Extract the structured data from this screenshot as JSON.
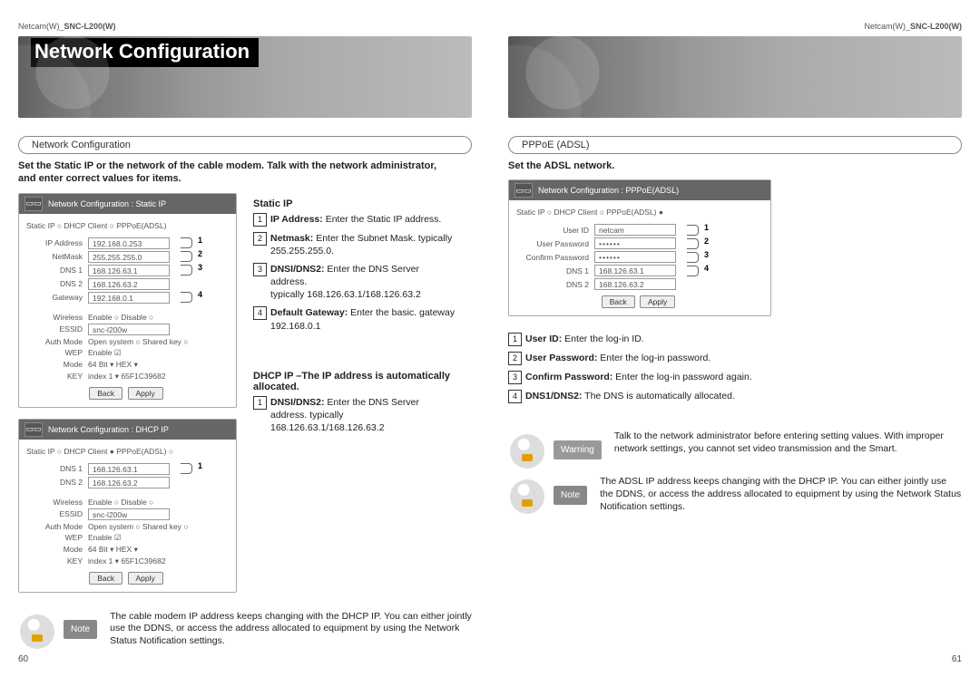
{
  "header": {
    "model_left": "Netcam(W)_",
    "model_bold": "SNC-L200(W)",
    "title": "Network Configuration"
  },
  "left": {
    "chip": "Network Configuration",
    "intro": "Set the Static IP or the network of the cable modem. Talk with the network administrator, and enter correct values for items.",
    "panel1_title": "Network Configuration : Static IP",
    "radio_a": "Static IP  ○ DHCP Client  ○ PPPoE(ADSL)",
    "fields1": {
      "ip_label": "IP Address",
      "ip_value": "192.168.0.253",
      "nm_label": "NetMask",
      "nm_value": "255.255.255.0",
      "d1_label": "DNS 1",
      "d1_value": "168.126.63.1",
      "d2_label": "DNS 2",
      "d2_value": "168.126.63.2",
      "gw_label": "Gateway",
      "gw_value": "192.168.0.1",
      "wl_label": "Wireless",
      "wl_value": "Enable  ○ Disable ○",
      "es_label": "ESSID",
      "es_value": "snc-l200w",
      "am_label": "Auth Mode",
      "am_value": "Open system ○  Shared key ○",
      "wep_label": "WEP",
      "wep_value": "Enable ☑",
      "md_label": "Mode",
      "md_value": "64 Bit ▾   HEX ▾",
      "ky_label": "KEY",
      "ky_value": "index 1 ▾  65F1C39682"
    },
    "panel2_title": "Network Configuration : DHCP IP",
    "radio_b": "Static IP ○  DHCP Client ●  PPPoE(ADSL) ○",
    "fields2": {
      "d1_label": "DNS 1",
      "d1_value": "168.126.63.1",
      "d2_label": "DNS 2",
      "d2_value": "168.126.63.2",
      "wl_label": "Wireless",
      "wl_value": "Enable ○  Disable ○",
      "es_label": "ESSID",
      "es_value": "snc-l200w",
      "am_label": "Auth Mode",
      "am_value": "Open system ○  Shared key ○",
      "wep_label": "WEP",
      "wep_value": "Enable ☑",
      "md_label": "Mode",
      "md_value": "64 Bit ▾   HEX ▾",
      "ky_label": "KEY",
      "ky_value": "index 1 ▾  65F1C39682"
    },
    "btn_back": "Back",
    "btn_apply": "Apply",
    "subhead1": "Static IP",
    "s1": {
      "b": "IP Address:",
      "t": " Enter the Static IP address."
    },
    "s2": {
      "b": "Netmask:",
      "t": " Enter the Subnet Mask. typically 255.255.255.0."
    },
    "s3": {
      "b": "DNSI/DNS2:",
      "t": " Enter the DNS Server address.",
      "t2": "typically 168.126.63.1/168.126.63.2"
    },
    "s4": {
      "b": "Default Gateway:",
      "t": " Enter the basic. gateway 192.168.0.1"
    },
    "subhead2": "DHCP IP –The IP address is automatically allocated.",
    "d1": {
      "b": "DNSI/DNS2:",
      "t": " Enter the DNS Server address. typically 168.126.63.1/168.126.63.2"
    },
    "note_tag": "Note",
    "note_text": "The cable modem IP address keeps changing with the DHCP IP. You can either jointly use the DDNS, or access the address allocated to equipment by using the Network Status Notification settings.",
    "page_num": "60"
  },
  "right": {
    "chip": "PPPoE (ADSL)",
    "intro": "Set the ADSL network.",
    "panel_title": "Network Configuration : PPPoE(ADSL)",
    "radio": "Static IP ○  DHCP Client ○  PPPoE(ADSL) ●",
    "fields": {
      "uid_label": "User ID",
      "uid_value": "netcam",
      "upw_label": "User Password",
      "upw_value": "••••••",
      "cpw_label": "Confirm Password",
      "cpw_value": "••••••",
      "d1_label": "DNS 1",
      "d1_value": "168.126.63.1",
      "d2_label": "DNS 2",
      "d2_value": "168.126.63.2"
    },
    "btn_back": "Back",
    "btn_apply": "Apply",
    "r1": {
      "b": "User ID:",
      "t": " Enter the log-in ID."
    },
    "r2": {
      "b": "User Password:",
      "t": " Enter the log-in password."
    },
    "r3": {
      "b": "Confirm Password:",
      "t": " Enter the log-in password again."
    },
    "r4": {
      "b": "DNS1/DNS2:",
      "t": " The DNS is automatically allocated."
    },
    "warn_tag": "Warning",
    "warn_text": "Talk to the network administrator before entering setting values. With improper network settings, you cannot set video transmission and the Smart.",
    "note_tag": "Note",
    "note_text": "The ADSL IP address keeps changing with the DHCP IP. You can either jointly use the DDNS, or access the address allocated to equipment by using the Network Status Notification settings.",
    "page_num": "61"
  }
}
